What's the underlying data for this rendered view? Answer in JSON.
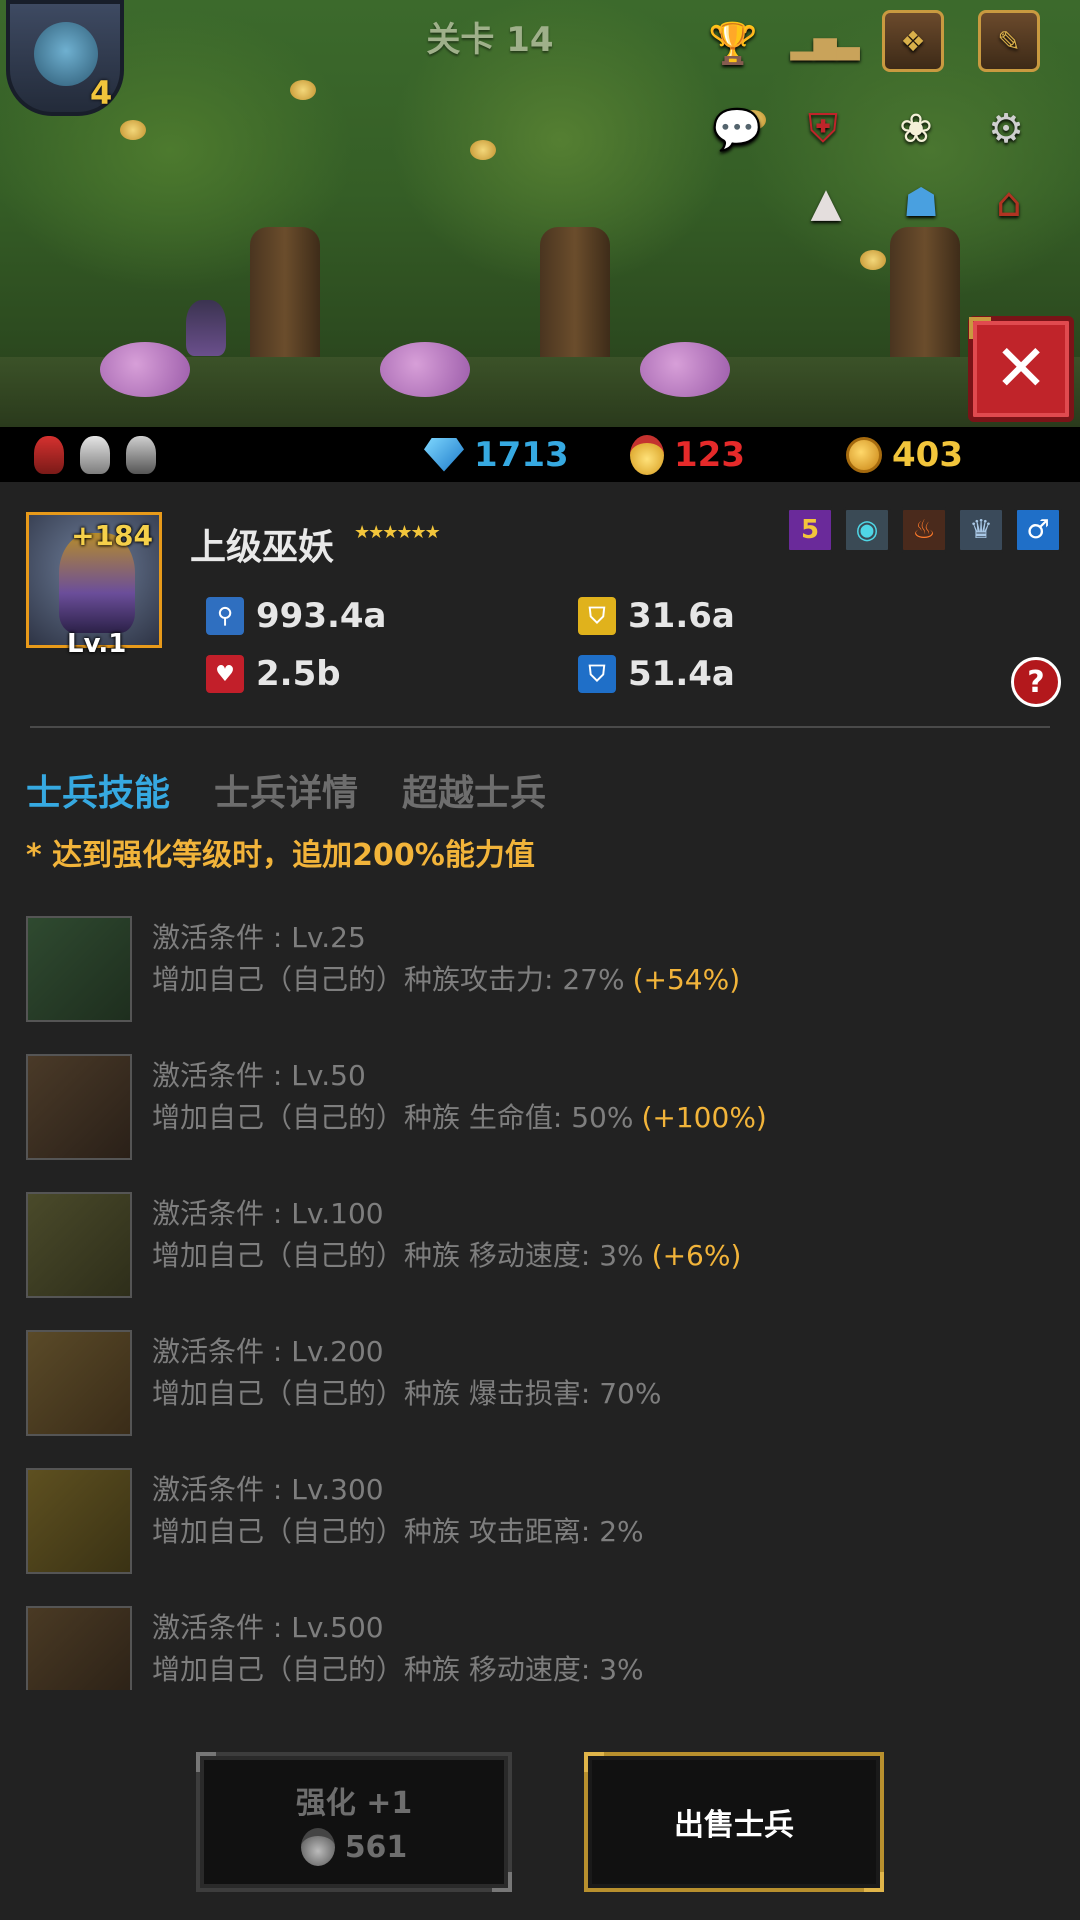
{
  "scene": {
    "stage_title": "关卡 14",
    "boss_level": "4",
    "close_symbol": "✕"
  },
  "hud_icons": [
    "trophy-icon",
    "leaderboard-icon",
    "codex-book-icon",
    "quest-book-icon",
    "chat-icon",
    "crest-icon",
    "angel-icon",
    "settings-icon",
    "warning-icon",
    "party-icon",
    "house-icon"
  ],
  "resources": {
    "gems": "1713",
    "medals": "123",
    "gold": "403",
    "gem_color": "#36a9e1",
    "medal_color": "#e52a2a",
    "gold_color": "#f2c53b"
  },
  "unit": {
    "name": "上级巫妖",
    "stars": "★★★★★★",
    "enhance": "+184",
    "level": "Lv.1",
    "badges": {
      "rank": "5"
    },
    "stats": {
      "attack": "993.4a",
      "defense": "31.6a",
      "hp": "2.5b",
      "magic_defense": "51.4a"
    },
    "help": "?"
  },
  "tabs": [
    {
      "label": "士兵技能",
      "active": true
    },
    {
      "label": "士兵详情",
      "active": false
    },
    {
      "label": "超越士兵",
      "active": false
    }
  ],
  "notice": "* 达到强化等级时，追加200%能力值",
  "skills": [
    {
      "cond": "激活条件 : Lv.25",
      "desc": "增加自己（自己的）种族攻击力: 27%",
      "bonus": "(+54%)"
    },
    {
      "cond": "激活条件 : Lv.50",
      "desc": "增加自己（自己的）种族 生命值: 50%",
      "bonus": "(+100%)"
    },
    {
      "cond": "激活条件 : Lv.100",
      "desc": "增加自己（自己的）种族 移动速度: 3%",
      "bonus": "(+6%)"
    },
    {
      "cond": "激活条件 : Lv.200",
      "desc": "增加自己（自己的）种族 爆击损害: 70%",
      "bonus": ""
    },
    {
      "cond": "激活条件 : Lv.300",
      "desc": "增加自己（自己的）种族 攻击距离: 2%",
      "bonus": ""
    },
    {
      "cond": "激活条件 : Lv.500",
      "desc": "增加自己（自己的）种族 移动速度: 3%",
      "bonus": ""
    }
  ],
  "buttons": {
    "upgrade_label": "强化 +1",
    "upgrade_cost": "561",
    "sell_label": "出售士兵"
  }
}
